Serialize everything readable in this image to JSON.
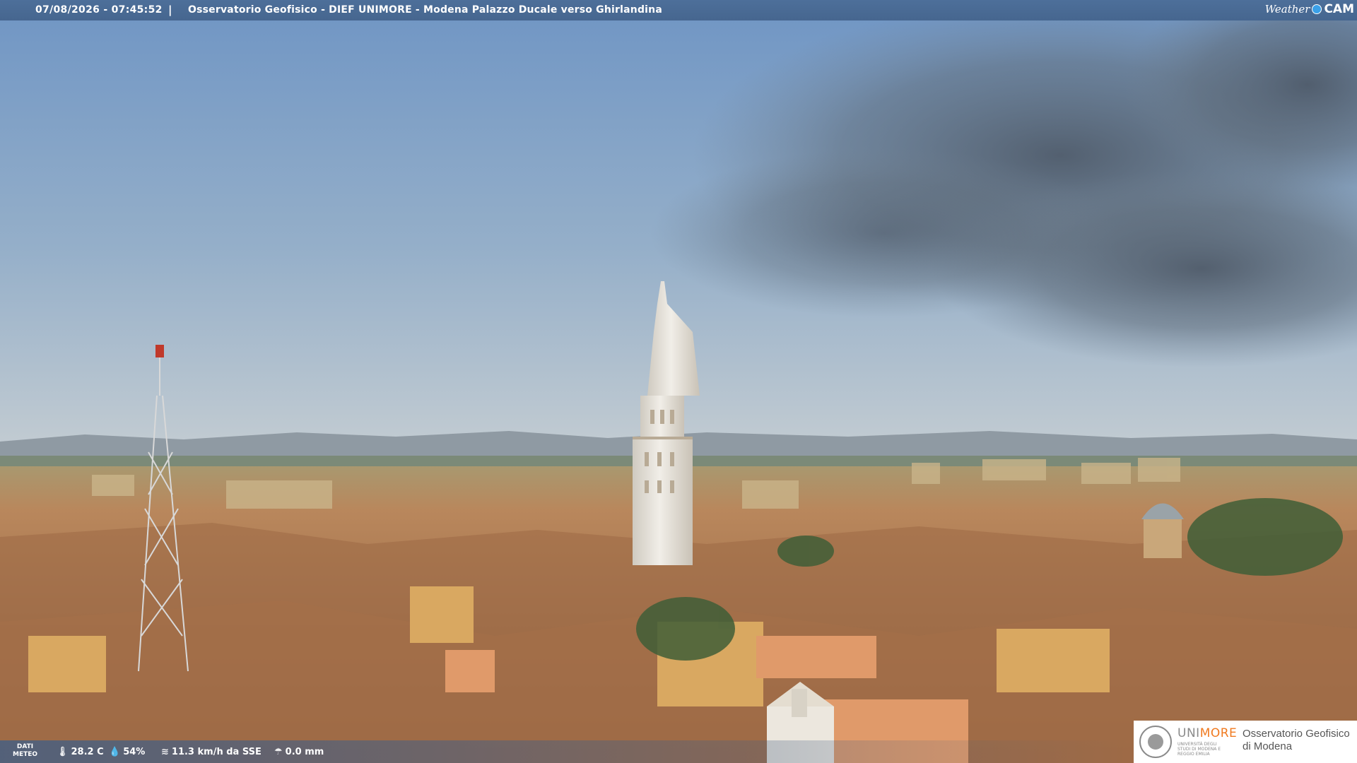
{
  "header": {
    "datetime": "07/08/2026 - 07:45:52",
    "separator": "|",
    "title": "Osservatorio Geofisico - DIEF UNIMORE - Modena Palazzo Ducale verso Ghirlandina",
    "brand_weather": "Weather",
    "brand_cam": "CAM"
  },
  "weather": {
    "label_line1": "DATI",
    "label_line2": "METEO",
    "temperature": "28.2 C",
    "humidity": "54%",
    "wind": "11.3 km/h da SSE",
    "rain": "0.0 mm",
    "icons": [
      "thermometer-icon",
      "humidity-drop-icon",
      "wind-icon",
      "rain-icon"
    ]
  },
  "logo": {
    "uni_prefix": "UNI",
    "uni_suffix": "MORE",
    "uni_subtitle": "UNIVERSITÀ DEGLI STUDI DI MODENA E REGGIO EMILIA",
    "observatory_line1": "Osservatorio Geofisico",
    "observatory_line2": "di Modena",
    "accent_color": "#f07a20"
  },
  "colors": {
    "sky_top": "#6f95c4",
    "sky_bottom": "#b8c8d6",
    "roof": "#b07a52",
    "tower": "#e6e3dc"
  }
}
